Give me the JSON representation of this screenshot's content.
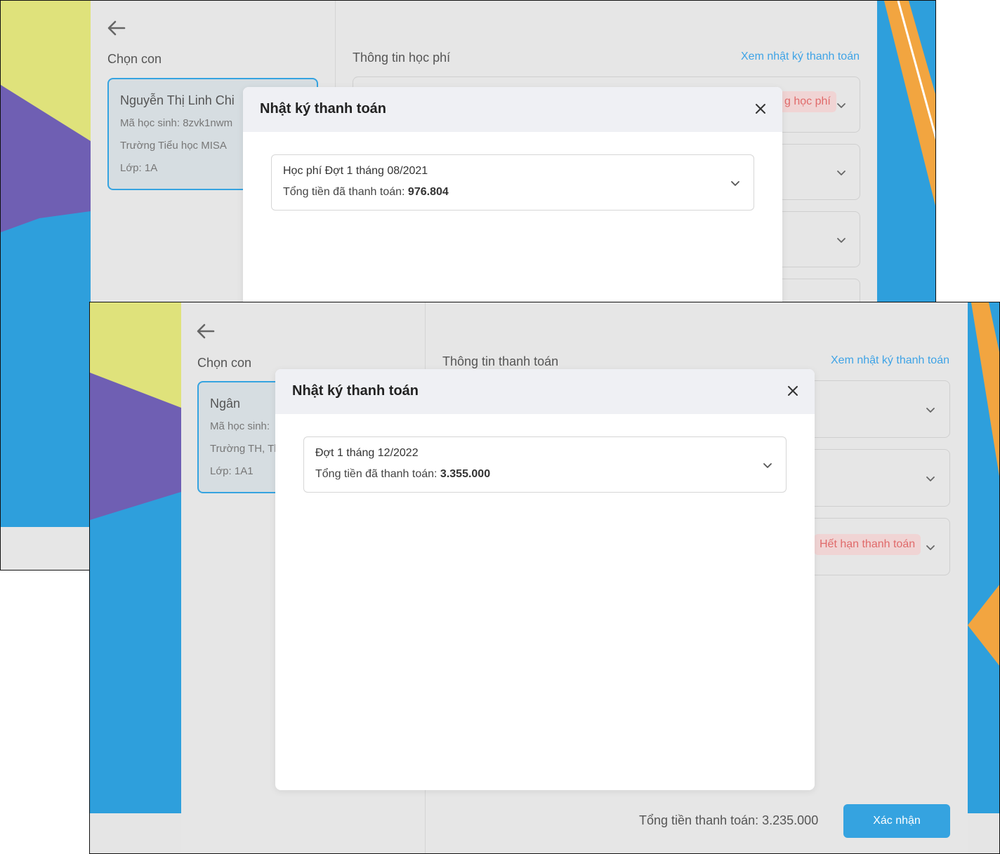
{
  "shot1": {
    "left_title": "Chọn con",
    "right_title": "Thông tin học phí",
    "log_link": "Xem nhật ký thanh toán",
    "child": {
      "name": "Nguyễn Thị Linh Chi",
      "student_id": "Mã học sinh: 8zvk1nwm",
      "school": "Trường Tiểu học MISA",
      "class": "Lớp: 1A"
    },
    "badge_partial": "g học phí",
    "modal": {
      "title": "Nhật ký thanh toán",
      "items": [
        {
          "title": "Học phí Đợt 1 tháng 08/2021",
          "total_label": "Tổng tiền đã thanh toán:",
          "total_value": "976.804"
        }
      ]
    }
  },
  "shot2": {
    "left_title": "Chọn con",
    "right_title": "Thông tin thanh toán",
    "log_link": "Xem nhật ký thanh toán",
    "child": {
      "name": "Ngân",
      "student_id": "Mã học sinh:",
      "school": "Trường TH, Tl",
      "class": "Lớp: 1A1"
    },
    "badge": "Hết hạn thanh toán",
    "modal": {
      "title": "Nhật ký thanh toán",
      "items": [
        {
          "title": "Đợt 1 tháng 12/2022",
          "total_label": "Tổng tiền đã thanh toán:",
          "total_value": "3.355.000"
        }
      ]
    },
    "footer_total": "Tổng tiền thanh toán: 3.235.000",
    "confirm_label": "Xác nhận"
  },
  "colors": {
    "accent": "#35a3e0",
    "link": "#3ea3e6",
    "danger_text": "#e06a6a",
    "danger_bg": "#f0d4d4",
    "modal_header": "#eff0f4",
    "bg_blue": "#2e9fdc",
    "bg_yellow": "#dfe27b",
    "bg_purple": "#6f5fb3",
    "bg_orange": "#f2a540"
  },
  "icons": [
    "arrow-left-icon",
    "close-icon",
    "chevron-down-icon"
  ]
}
